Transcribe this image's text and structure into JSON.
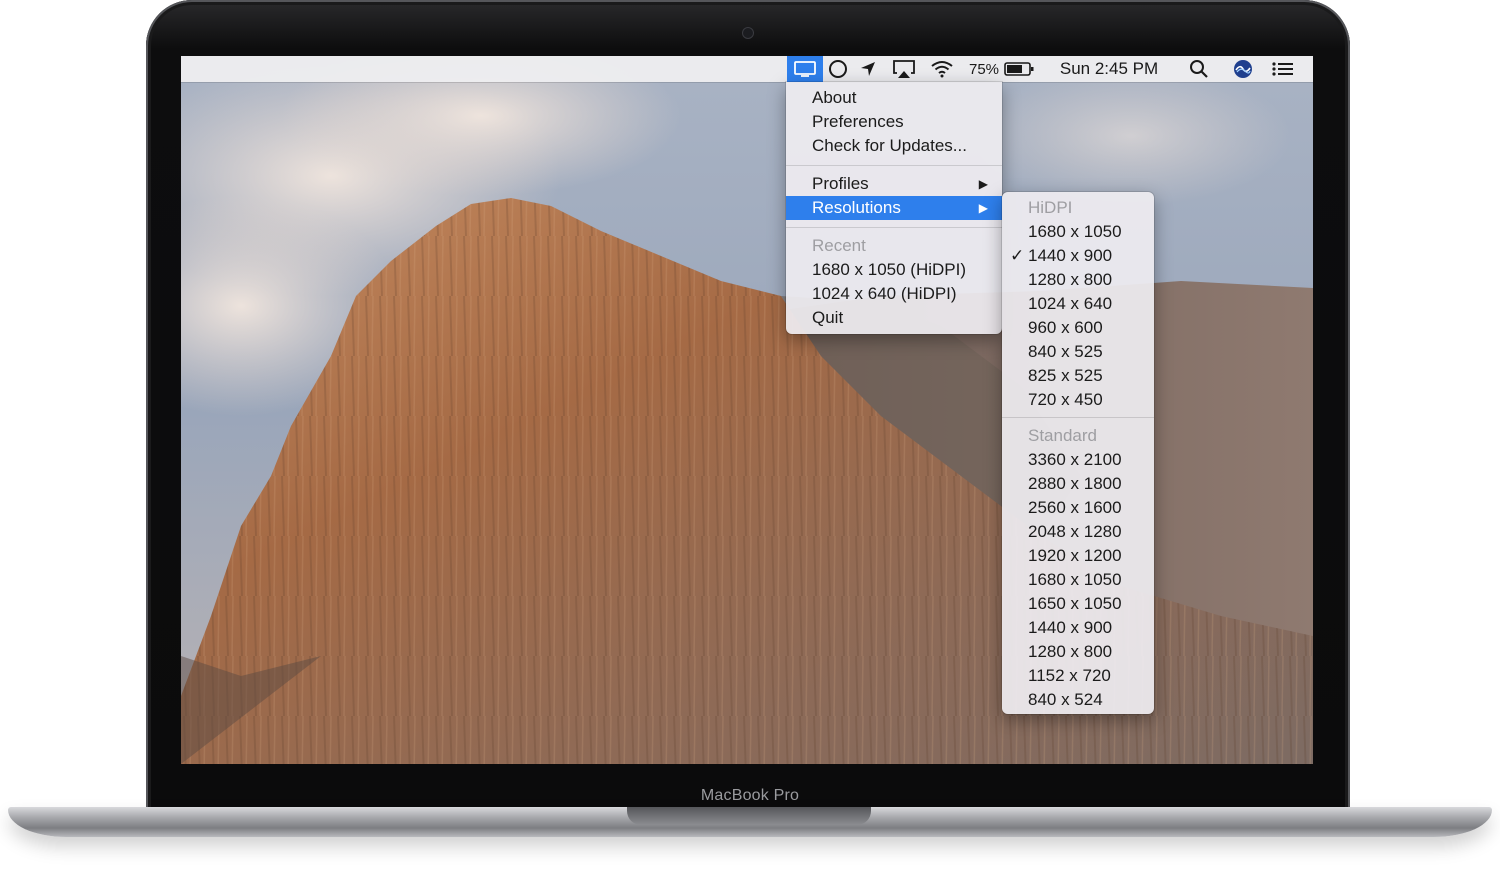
{
  "device": {
    "label": "MacBook Pro"
  },
  "menubar": {
    "battery_percent": "75%",
    "clock": "Sun 2:45 PM",
    "icons": [
      "display-menu-icon",
      "circle-icon",
      "location-arrow-icon",
      "airplay-icon",
      "wifi-icon",
      "battery-icon",
      "search-icon",
      "siri-icon",
      "notification-center-icon"
    ]
  },
  "app_menu": {
    "about": "About",
    "preferences": "Preferences",
    "check_updates": "Check for Updates...",
    "profiles": "Profiles",
    "resolutions": "Resolutions",
    "recent_header": "Recent",
    "recent_items": [
      "1680 x 1050 (HiDPI)",
      "1024 x 640 (HiDPI)"
    ],
    "quit": "Quit",
    "submenu_arrow": "▶"
  },
  "resolutions_submenu": {
    "hidpi_header": "HiDPI",
    "hidpi": [
      "1680 x 1050",
      "1440 x 900",
      "1280 x 800",
      "1024 x 640",
      "960 x 600",
      "840 x 525",
      "825 x 525",
      "720 x 450"
    ],
    "selected": "1440 x 900",
    "check_mark": "✓",
    "standard_header": "Standard",
    "standard": [
      "3360 x 2100",
      "2880 x 1800",
      "2560 x 1600",
      "2048 x 1280",
      "1920 x 1200",
      "1680 x 1050",
      "1650 x 1050",
      "1440 x 900",
      "1280 x 800",
      "1152 x 720",
      "840 x 524"
    ]
  },
  "colors": {
    "highlight": "#2e7fec",
    "menubar": "#eeeef0"
  }
}
